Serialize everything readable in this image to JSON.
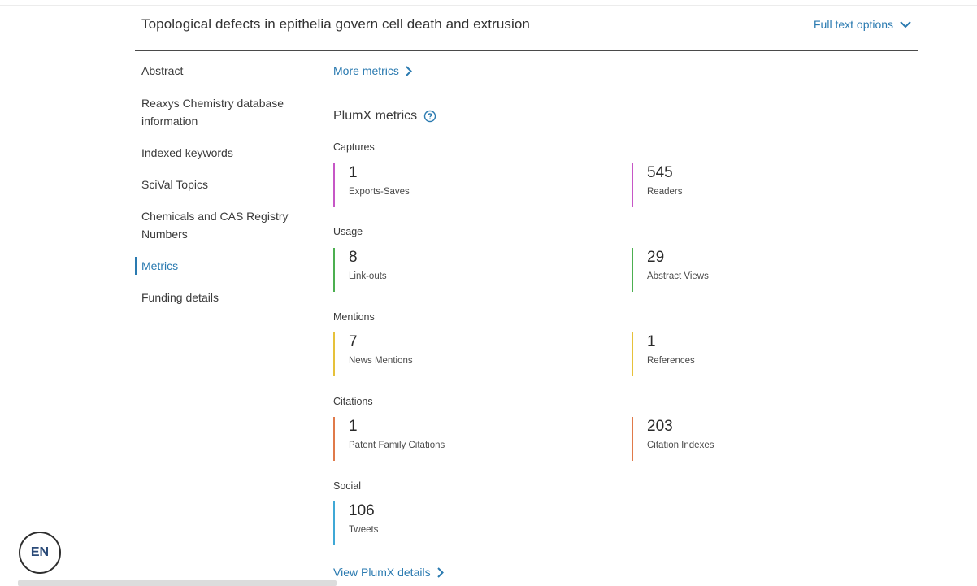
{
  "header": {
    "title": "Topological defects in epithelia govern cell death and extrusion",
    "full_text_options": "Full text options"
  },
  "nav": {
    "items": [
      {
        "label": "Abstract"
      },
      {
        "label": "Reaxys Chemistry database information"
      },
      {
        "label": "Indexed keywords"
      },
      {
        "label": "SciVal Topics"
      },
      {
        "label": "Chemicals and CAS Registry Numbers"
      },
      {
        "label": "Metrics",
        "active": true
      },
      {
        "label": "Funding details"
      }
    ]
  },
  "main": {
    "more_metrics": "More metrics",
    "plumx_title": "PlumX metrics",
    "view_details": "View PlumX details",
    "sections": [
      {
        "label": "Captures",
        "color": "#c657c6",
        "metrics": [
          {
            "value": "1",
            "label": "Exports-Saves"
          },
          {
            "value": "545",
            "label": "Readers"
          }
        ]
      },
      {
        "label": "Usage",
        "color": "#4caf50",
        "metrics": [
          {
            "value": "8",
            "label": "Link-outs"
          },
          {
            "value": "29",
            "label": "Abstract Views"
          }
        ]
      },
      {
        "label": "Mentions",
        "color": "#e6c13a",
        "metrics": [
          {
            "value": "7",
            "label": "News Mentions"
          },
          {
            "value": "1",
            "label": "References"
          }
        ]
      },
      {
        "label": "Citations",
        "color": "#e07a4a",
        "metrics": [
          {
            "value": "1",
            "label": "Patent Family Citations"
          },
          {
            "value": "203",
            "label": "Citation Indexes"
          }
        ]
      },
      {
        "label": "Social",
        "color": "#3fa8d6",
        "metrics": [
          {
            "value": "106",
            "label": "Tweets"
          }
        ]
      }
    ]
  },
  "lang": {
    "code": "EN"
  },
  "colors": {
    "accent": "#2a7ab0"
  },
  "icons": {
    "full_text_chevron": "chevron-down-icon",
    "link_chevron": "chevron-right-icon",
    "help": "question-circle-icon"
  }
}
